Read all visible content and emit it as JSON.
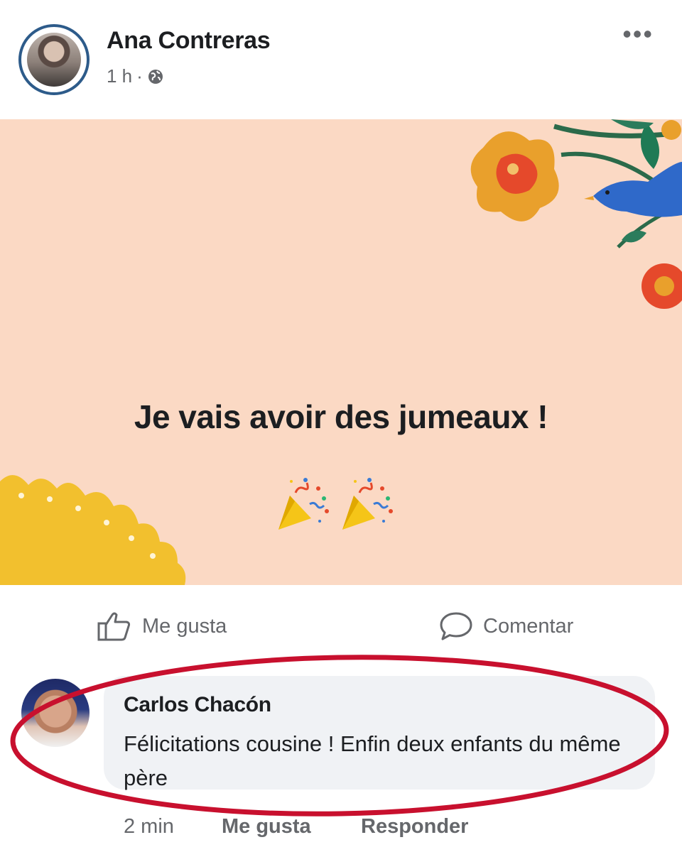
{
  "post": {
    "author": "Ana Contreras",
    "time": "1 h",
    "separator": "·",
    "more_label": "•••",
    "text": "Je vais avoir des jumeaux !",
    "emoji": "party-popper-emoji"
  },
  "actions": {
    "like_label": "Me gusta",
    "comment_label": "Comentar"
  },
  "comment": {
    "author": "Carlos Chacón",
    "text": "Félicitations cousine ! Enfin deux enfants du même père",
    "time": "2 min",
    "like_label": "Me gusta",
    "reply_label": "Responder"
  },
  "colors": {
    "post_background": "#fbd9c4",
    "highlight_ring": "#c8102e",
    "secondary_text": "#65676b"
  }
}
